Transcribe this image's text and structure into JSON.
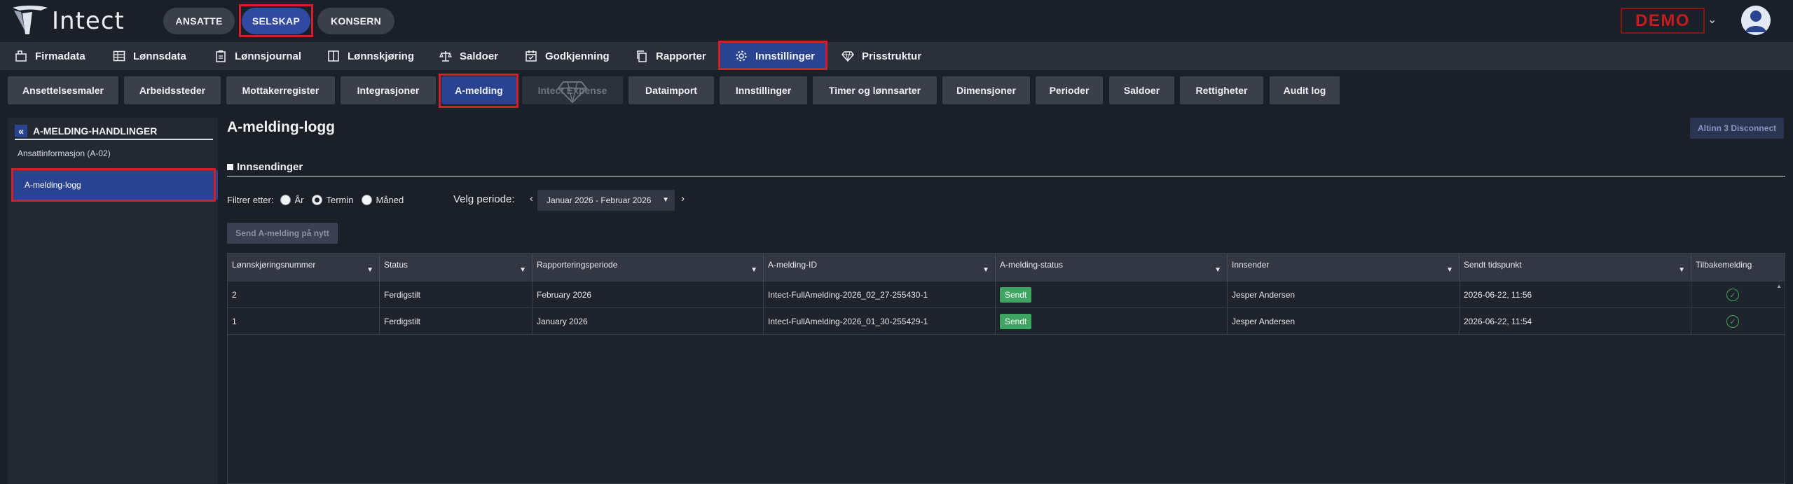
{
  "app": {
    "brand": "Intect",
    "top_tabs": [
      "ANSATTE",
      "SELSKAP",
      "KONSERN"
    ],
    "demo_label": "DEMO"
  },
  "nav": {
    "items": [
      {
        "label": "Firmadata",
        "icon": "building-icon"
      },
      {
        "label": "Lønnsdata",
        "icon": "table-icon"
      },
      {
        "label": "Lønnsjournal",
        "icon": "clipboard-icon"
      },
      {
        "label": "Lønnskjøring",
        "icon": "columns-icon"
      },
      {
        "label": "Saldoer",
        "icon": "scale-icon"
      },
      {
        "label": "Godkjenning",
        "icon": "calendar-check-icon"
      },
      {
        "label": "Rapporter",
        "icon": "copy-icon"
      },
      {
        "label": "Innstillinger",
        "icon": "gear-icon"
      },
      {
        "label": "Prisstruktur",
        "icon": "diamond-icon"
      }
    ]
  },
  "subnav": {
    "items": [
      "Ansettelsesmaler",
      "Arbeidssteder",
      "Mottakerregister",
      "Integrasjoner",
      "A-melding",
      "Intect Expense",
      "Dataimport",
      "Innstillinger",
      "Timer og lønnsarter",
      "Dimensjoner",
      "Perioder",
      "Saldoer",
      "Rettigheter",
      "Audit log"
    ]
  },
  "sidebar": {
    "title": "A-MELDING-HANDLINGER",
    "items": [
      "Ansattinformasjon (A-02)",
      "A-melding-logg"
    ]
  },
  "main": {
    "title": "A-melding-logg",
    "altinn_button": "Altinn 3 Disconnect",
    "section_title": "Innsendinger",
    "filter_label": "Filtrer etter:",
    "filter_options": [
      "År",
      "Termin",
      "Måned"
    ],
    "filter_selected": "Termin",
    "period_label": "Velg periode:",
    "period_value": "Januar 2026 - Februar 2026",
    "send_button": "Send A-melding på nytt"
  },
  "table": {
    "columns": [
      "Lønnskjøringsnummer",
      "Status",
      "Rapporteringsperiode",
      "A-melding-ID",
      "A-melding-status",
      "Innsender",
      "Sendt tidspunkt",
      "Tilbakemelding"
    ],
    "rows": [
      {
        "nr": "2",
        "status": "Ferdigstilt",
        "period": "February 2026",
        "id": "Intect-FullAmelding-2026_02_27-255430-1",
        "mstatus": "Sendt",
        "sender": "Jesper Andersen",
        "sent": "2026-06-22, 11:56"
      },
      {
        "nr": "1",
        "status": "Ferdigstilt",
        "period": "January 2026",
        "id": "Intect-FullAmelding-2026_01_30-255429-1",
        "mstatus": "Sendt",
        "sender": "Jesper Andersen",
        "sent": "2026-06-22, 11:54"
      }
    ]
  },
  "colors": {
    "accent": "#2a4390",
    "highlight": "#d31f28",
    "success": "#3fa562"
  }
}
